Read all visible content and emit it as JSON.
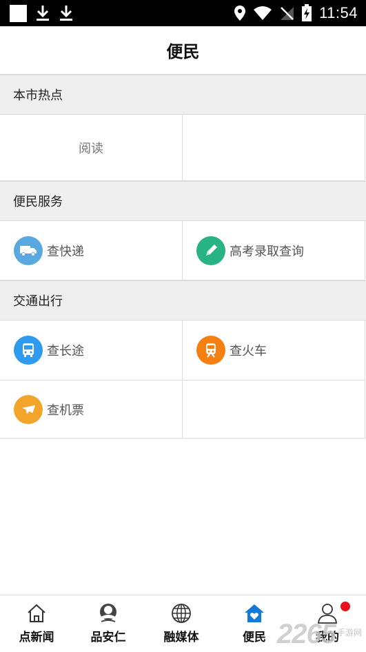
{
  "status_bar": {
    "time": "11:54"
  },
  "header": {
    "title": "便民"
  },
  "sections": [
    {
      "title": "本市热点",
      "items": [
        {
          "label": "阅读"
        }
      ]
    },
    {
      "title": "便民服务",
      "items": [
        {
          "label": "查快递",
          "icon": "truck-icon",
          "color": "#5aa8e0"
        },
        {
          "label": "高考录取查询",
          "icon": "pencil-icon",
          "color": "#27b383"
        }
      ]
    },
    {
      "title": "交通出行",
      "items": [
        {
          "label": "查长途",
          "icon": "bus-icon",
          "color": "#2e9af0"
        },
        {
          "label": "查火车",
          "icon": "train-icon",
          "color": "#f57f10"
        },
        {
          "label": "查机票",
          "icon": "airplane-icon",
          "color": "#f2a52a"
        }
      ]
    }
  ],
  "tabbar": {
    "tabs": [
      {
        "label": "点新闻",
        "icon": "home-icon"
      },
      {
        "label": "品安仁",
        "icon": "logo-icon"
      },
      {
        "label": "融媒体",
        "icon": "globe-icon"
      },
      {
        "label": "便民",
        "icon": "home-heart-icon",
        "active": true
      },
      {
        "label": "我的",
        "icon": "user-icon",
        "badge": true
      }
    ],
    "active_color": "#1479d6"
  },
  "watermark": {
    "number": "2265",
    "text": "手游网"
  }
}
